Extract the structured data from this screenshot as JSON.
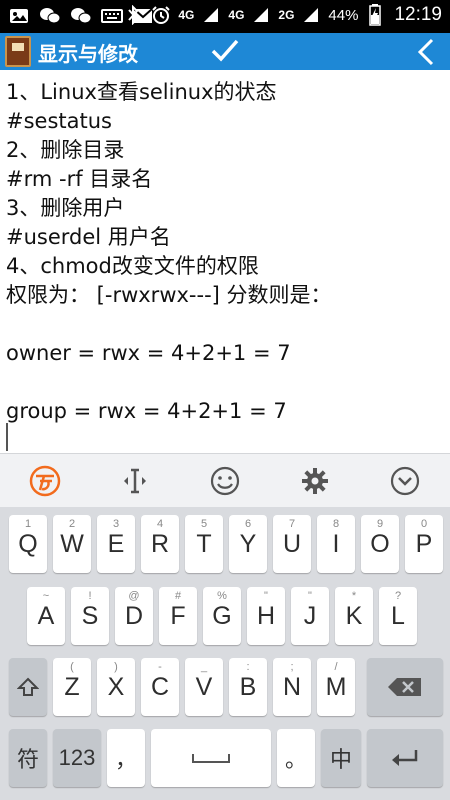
{
  "status_bar": {
    "network_4g_a": "4G",
    "network_4g_b": "4G",
    "network_2g": "2G",
    "battery_percent": "44%",
    "time": "12:19"
  },
  "app_bar": {
    "title": "显示与修改",
    "accent_color": "#1e88d6"
  },
  "editor": {
    "lines": [
      "1、Linux查看selinux的状态",
      "#sestatus",
      "2、删除目录",
      "#rm -rf 目录名",
      "3、删除用户",
      "#userdel 用户名",
      "4、chmod改变文件的权限",
      "权限为： [-rwxrwx---] 分数则是：",
      "",
      "owner = rwx = 4+2+1 = 7",
      "",
      "group = rwx = 4+2+1 = 7"
    ]
  },
  "keyboard": {
    "row1": [
      {
        "key": "Q",
        "hint": "1"
      },
      {
        "key": "W",
        "hint": "2"
      },
      {
        "key": "E",
        "hint": "3"
      },
      {
        "key": "R",
        "hint": "4"
      },
      {
        "key": "T",
        "hint": "5"
      },
      {
        "key": "Y",
        "hint": "6"
      },
      {
        "key": "U",
        "hint": "7"
      },
      {
        "key": "I",
        "hint": "8"
      },
      {
        "key": "O",
        "hint": "9"
      },
      {
        "key": "P",
        "hint": "0"
      }
    ],
    "row2": [
      {
        "key": "A",
        "hint": "~"
      },
      {
        "key": "S",
        "hint": "!"
      },
      {
        "key": "D",
        "hint": "@"
      },
      {
        "key": "F",
        "hint": "#"
      },
      {
        "key": "G",
        "hint": "%"
      },
      {
        "key": "H",
        "hint": "\""
      },
      {
        "key": "J",
        "hint": "\""
      },
      {
        "key": "K",
        "hint": "*"
      },
      {
        "key": "L",
        "hint": "?"
      }
    ],
    "row3": [
      {
        "key": "Z",
        "hint": "("
      },
      {
        "key": "X",
        "hint": ")"
      },
      {
        "key": "C",
        "hint": "-"
      },
      {
        "key": "V",
        "hint": "_"
      },
      {
        "key": "B",
        "hint": ":"
      },
      {
        "key": "N",
        "hint": ";"
      },
      {
        "key": "M",
        "hint": "/"
      }
    ],
    "row4": {
      "symbol": "符",
      "numbers": "123",
      "comma": "，",
      "period": "。",
      "lang": "中"
    }
  }
}
